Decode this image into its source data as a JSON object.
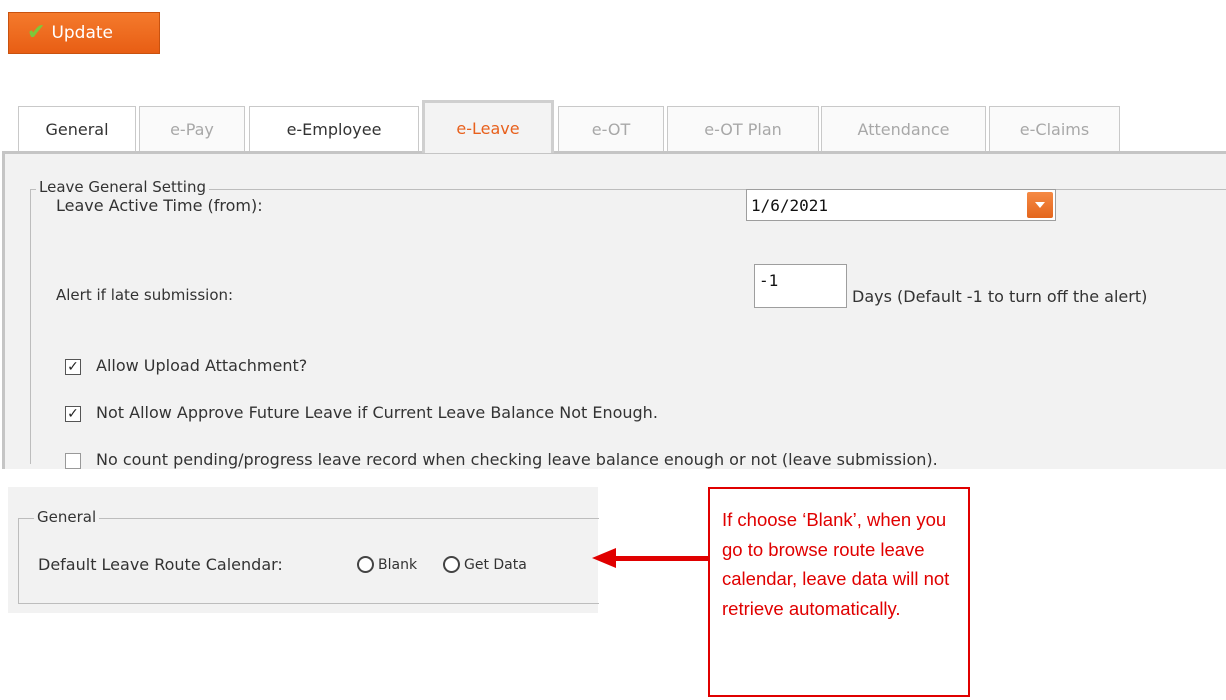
{
  "toolbar": {
    "update_label": "Update"
  },
  "tabs": [
    {
      "label": "General",
      "state": "enabled"
    },
    {
      "label": "e-Pay",
      "state": "disabled"
    },
    {
      "label": "e-Employee",
      "state": "enabled"
    },
    {
      "label": "e-Leave",
      "state": "active"
    },
    {
      "label": "e-OT",
      "state": "disabled"
    },
    {
      "label": "e-OT Plan",
      "state": "disabled"
    },
    {
      "label": "Attendance",
      "state": "disabled"
    },
    {
      "label": "e-Claims",
      "state": "disabled"
    }
  ],
  "leave_general": {
    "legend": "Leave General Setting",
    "active_time_label": "Leave Active Time (from):",
    "active_time_value": "1/6/2021",
    "late_label": "Alert if late submission:",
    "late_value": "-1",
    "late_suffix": "Days (Default -1 to turn off the alert)",
    "options": [
      {
        "label": "Allow Upload Attachment?",
        "checked": true
      },
      {
        "label": "Not Allow Approve Future Leave if Current Leave Balance Not Enough.",
        "checked": true
      },
      {
        "label": "No count pending/progress leave record when checking leave balance enough or not (leave submission).",
        "checked": false
      }
    ]
  },
  "general": {
    "legend": "General",
    "route_label": "Default Leave Route Calendar:",
    "radio_blank": "Blank",
    "radio_get_data": "Get Data"
  },
  "callout": {
    "text": "If choose ‘Blank’, when you go to browse route leave calendar, leave data will not retrieve automatically."
  },
  "colors": {
    "accent": "#e8601c",
    "annotation": "#e00000",
    "check_icon": "#7ec83a"
  }
}
